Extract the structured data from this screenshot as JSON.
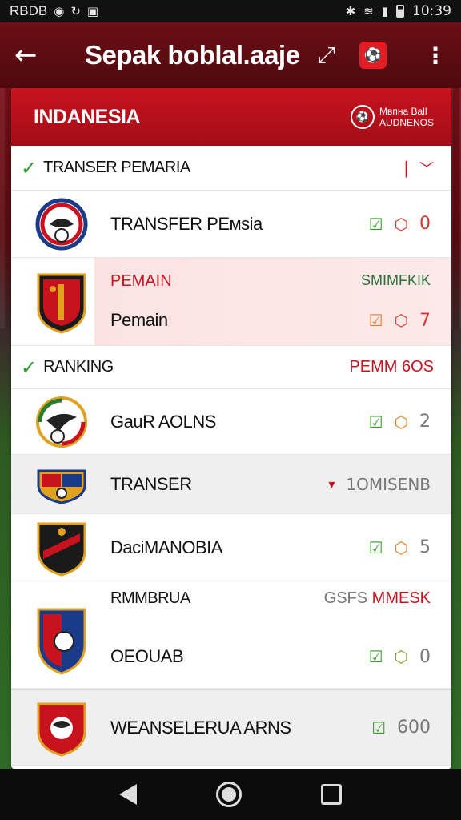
{
  "status_bar": {
    "left_text": "RBDB",
    "time": "10:39",
    "icons": [
      "app-icon",
      "sync-icon",
      "image-icon",
      "bluetooth-icon",
      "wifi-icon",
      "signal-icon",
      "battery-icon"
    ]
  },
  "app_bar": {
    "title": "Sepak boblal.aaje",
    "back_icon": "arrow-left-icon",
    "share_icon": "share-icon",
    "more_icon": "more-vertical-icon"
  },
  "card": {
    "title": "INDANESIA",
    "brand_line1": "Mвпна Ваll",
    "brand_line2": "AUDNENOS"
  },
  "sections": {
    "transfer": {
      "label": "TRANSER PEMARIA"
    },
    "ranking": {
      "label": "RANKING",
      "right": "PEMM 6OS"
    }
  },
  "rows": {
    "r1": {
      "name": "TRANSFER PЕмsia",
      "score": "0"
    },
    "r2": {
      "top_left": "PEMAIN",
      "top_right": "SMIMFKIK",
      "name": "Pemain",
      "score": "7"
    },
    "r3": {
      "name": "GauR AOLNS",
      "score": "2"
    },
    "r4": {
      "name": "TRANSER",
      "right": "1OMISENB"
    },
    "r5": {
      "name": "DaciMANOBIA",
      "score": "5"
    },
    "r6": {
      "top_left": "RMMBRUA",
      "top_right_a": "GSFS",
      "top_right_b": "MMESK",
      "name": "OEOUAB",
      "score": "0"
    },
    "r7": {
      "name": "WEANSELERUA ARNS",
      "score": "600"
    }
  },
  "colors": {
    "brand_red": "#c8131f",
    "check_green": "#2e9b2e",
    "dark_red": "#5a0c12"
  }
}
